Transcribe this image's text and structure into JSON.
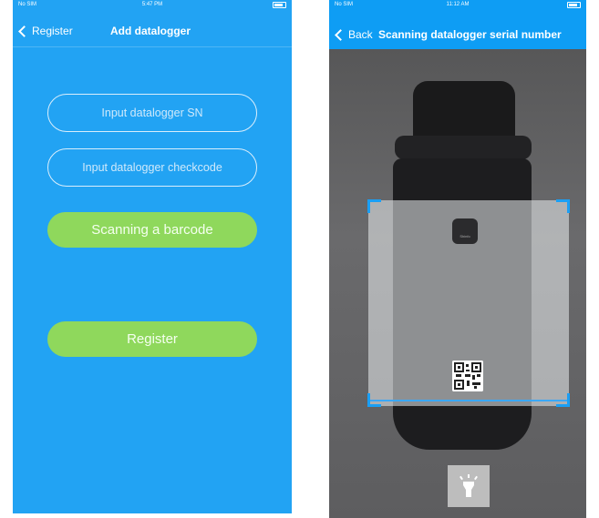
{
  "left_screen": {
    "status": {
      "carrier": "No SIM",
      "time": "5:47 PM"
    },
    "nav": {
      "back_label": "Register",
      "title": "Add datalogger"
    },
    "form": {
      "sn_placeholder": "Input datalogger SN",
      "checkcode_placeholder": "Input datalogger checkcode",
      "scan_button": "Scanning a barcode",
      "register_button": "Register"
    },
    "colors": {
      "background": "#22a3f3",
      "button": "#8fd85c"
    }
  },
  "right_screen": {
    "status": {
      "carrier": "No SIM",
      "time": "11:12 AM"
    },
    "nav": {
      "back_label": "Back",
      "title": "Scanning datalogger serial number"
    },
    "device_logo_text": "Shinfo",
    "torch_icon": "flashlight-icon",
    "colors": {
      "navbar": "#0e9df4",
      "scan_corner": "#1a9ff5"
    }
  }
}
